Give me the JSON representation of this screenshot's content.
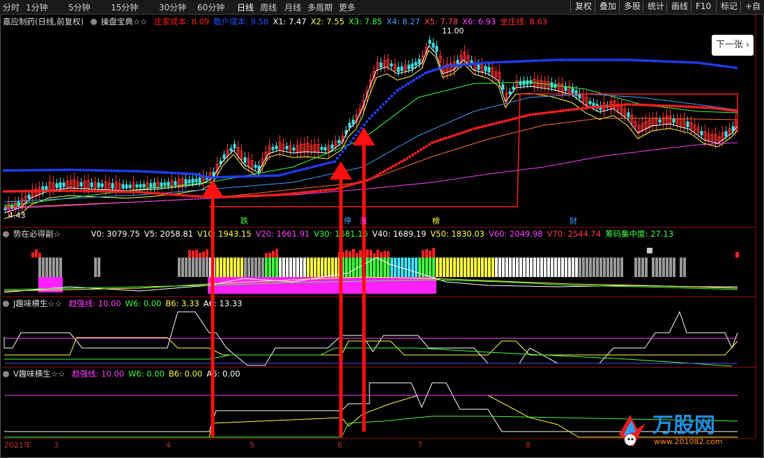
{
  "toolbar": {
    "periods": [
      "分时",
      "1分钟",
      "5分钟",
      "15分钟",
      "30分钟",
      "60分钟",
      "日线",
      "周线",
      "月线",
      "多周期",
      "更多"
    ],
    "active": "日线",
    "right_buttons": [
      "复权",
      "叠加",
      "多股",
      "统计",
      "画线",
      "F10",
      "标记",
      "+自"
    ]
  },
  "main_panel": {
    "stock": "嘉应制药(日线,前复权)",
    "indicator": "操盘宝典☆☆",
    "values": [
      {
        "label": "庄家成本:",
        "value": "8.09",
        "color": "#ff2020"
      },
      {
        "label": "散户成本:",
        "value": "9.58",
        "color": "#2050ff"
      },
      {
        "label": "X1:",
        "value": "7.47",
        "color": "#ffffff"
      },
      {
        "label": "X2:",
        "value": "7.55",
        "color": "#ffff40"
      },
      {
        "label": "X3:",
        "value": "7.85",
        "color": "#40ff40"
      },
      {
        "label": "X4:",
        "value": "8.27",
        "color": "#40a0ff"
      },
      {
        "label": "X5:",
        "value": "7.78",
        "color": "#ff5050"
      },
      {
        "label": "X6:",
        "value": "6.93",
        "color": "#ff40ff"
      },
      {
        "label": "坐庄线:",
        "value": "8.63",
        "color": "#ff3030"
      }
    ],
    "high_label": "11.00",
    "low_label": "4.43",
    "markers": [
      "跌",
      "停",
      "涨",
      "榜",
      "财"
    ],
    "next_button": "下一张"
  },
  "volume_panel": {
    "title": "势在必得副☆",
    "values": [
      {
        "label": "V0:",
        "value": "3079.75",
        "color": "#ffffff"
      },
      {
        "label": "V5:",
        "value": "2058.81",
        "color": "#ffffff"
      },
      {
        "label": "V10:",
        "value": "1943.15",
        "color": "#ffff40"
      },
      {
        "label": "V20:",
        "value": "1661.91",
        "color": "#ff40ff"
      },
      {
        "label": "V30:",
        "value": "1681.16",
        "color": "#40ff40"
      },
      {
        "label": "V40:",
        "value": "1689.19",
        "color": "#ffffff"
      },
      {
        "label": "V50:",
        "value": "1830.03",
        "color": "#ffff40"
      },
      {
        "label": "V60:",
        "value": "2049.98",
        "color": "#ff40ff"
      },
      {
        "label": "V70:",
        "value": "2544.74",
        "color": "#ff4040"
      },
      {
        "label": "筹码集中度:",
        "value": "27.13",
        "color": "#40ff40"
      }
    ]
  },
  "j_panel": {
    "title": "J趣味横生☆☆",
    "values": [
      {
        "label": "趋强线:",
        "value": "10.00",
        "color": "#ff40ff"
      },
      {
        "label": "W6:",
        "value": "0.00",
        "color": "#40ff40"
      },
      {
        "label": "B6:",
        "value": "3.33",
        "color": "#ffff40"
      },
      {
        "label": "A6:",
        "value": "13.33",
        "color": "#ffffff"
      }
    ]
  },
  "v_panel": {
    "title": "V趣味横生☆☆",
    "values": [
      {
        "label": "趋强线:",
        "value": "10.00",
        "color": "#ff40ff"
      },
      {
        "label": "W6:",
        "value": "0.00",
        "color": "#40ff40"
      },
      {
        "label": "B6:",
        "value": "0.00",
        "color": "#ffff40"
      },
      {
        "label": "A6:",
        "value": "0.00",
        "color": "#ffffff"
      }
    ]
  },
  "x_axis": {
    "year": "2021年",
    "months": [
      "3",
      "4",
      "5",
      "6",
      "7",
      "8"
    ]
  },
  "watermark": {
    "brand": "万股网",
    "url": "www.201082.com"
  }
}
